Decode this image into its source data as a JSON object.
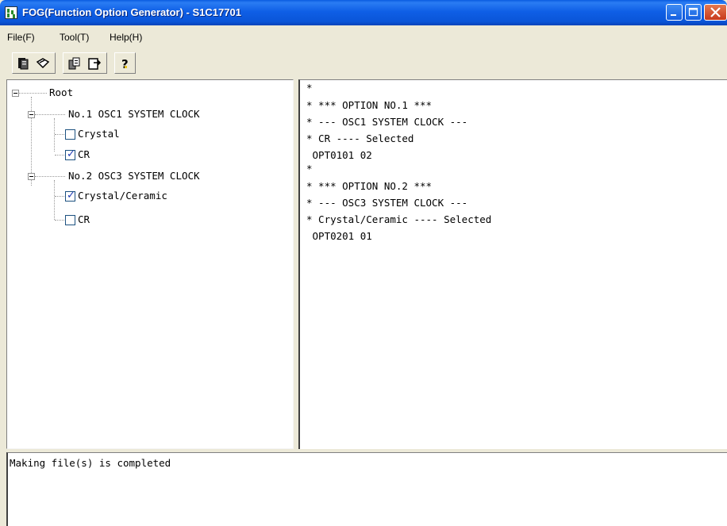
{
  "window": {
    "title": "FOG(Function Option Generator) - S1C17701",
    "icon": "app-icon",
    "controls": [
      "minimize-icon",
      "maximize-icon",
      "close-icon"
    ]
  },
  "menu": [
    {
      "label": "File(F)"
    },
    {
      "label": "Tool(T)"
    },
    {
      "label": "Help(H)"
    }
  ],
  "toolbar": {
    "buttons": [
      "open-icon",
      "edit-icon",
      "generate-icon",
      "export-icon",
      "help-icon"
    ]
  },
  "tree": {
    "root": "Root",
    "options": [
      {
        "label": "No.1 OSC1 SYSTEM CLOCK",
        "items": [
          {
            "label": "Crystal",
            "checked": false
          },
          {
            "label": "CR",
            "checked": true
          }
        ]
      },
      {
        "label": "No.2 OSC3 SYSTEM CLOCK",
        "items": [
          {
            "label": "Crystal/Ceramic",
            "checked": true
          },
          {
            "label": "CR",
            "checked": false
          }
        ]
      }
    ]
  },
  "output": {
    "lines": [
      "*",
      "* *** OPTION NO.1 ***",
      "* --- OSC1 SYSTEM CLOCK ---",
      "* CR ---- Selected",
      " OPT0101 02",
      "*",
      "* *** OPTION NO.2 ***",
      "* --- OSC3 SYSTEM CLOCK ---",
      "* Crystal/Ceramic ---- Selected",
      " OPT0201 01"
    ]
  },
  "status": {
    "message": "Making file(s) is completed"
  },
  "colors": {
    "titlebar": "#0a55d8",
    "checkmark": "#1f3bb5",
    "window_bg": "#ece9d8"
  }
}
